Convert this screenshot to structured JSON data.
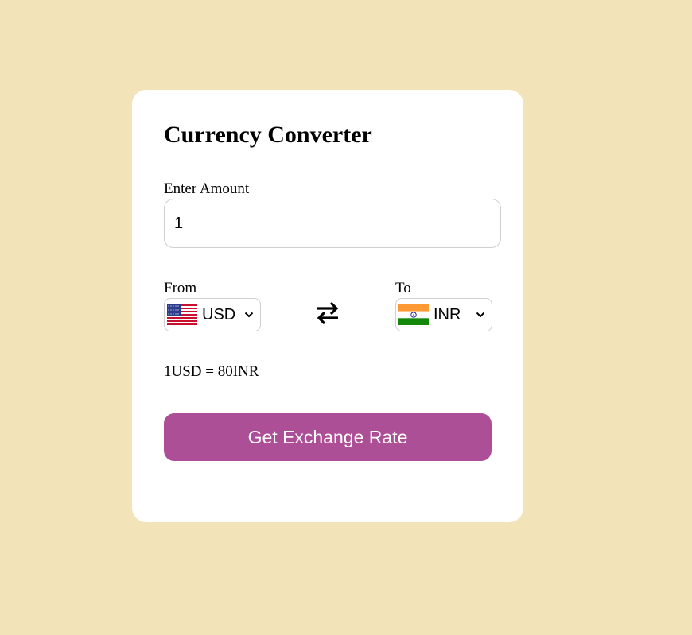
{
  "converter": {
    "title": "Currency Converter",
    "amount_label": "Enter Amount",
    "amount_value": "1",
    "from": {
      "label": "From",
      "currency": "USD",
      "flag_icon": "us-flag-icon"
    },
    "to": {
      "label": "To",
      "currency": "INR",
      "flag_icon": "india-flag-icon"
    },
    "swap_icon": "swap-arrows-icon",
    "rate_message": "1USD = 80INR",
    "button_label": "Get Exchange Rate"
  },
  "colors": {
    "page_background": "#f2e3b9",
    "card_background": "#ffffff",
    "button": "#ad4f96",
    "button_text": "#ffffff"
  }
}
